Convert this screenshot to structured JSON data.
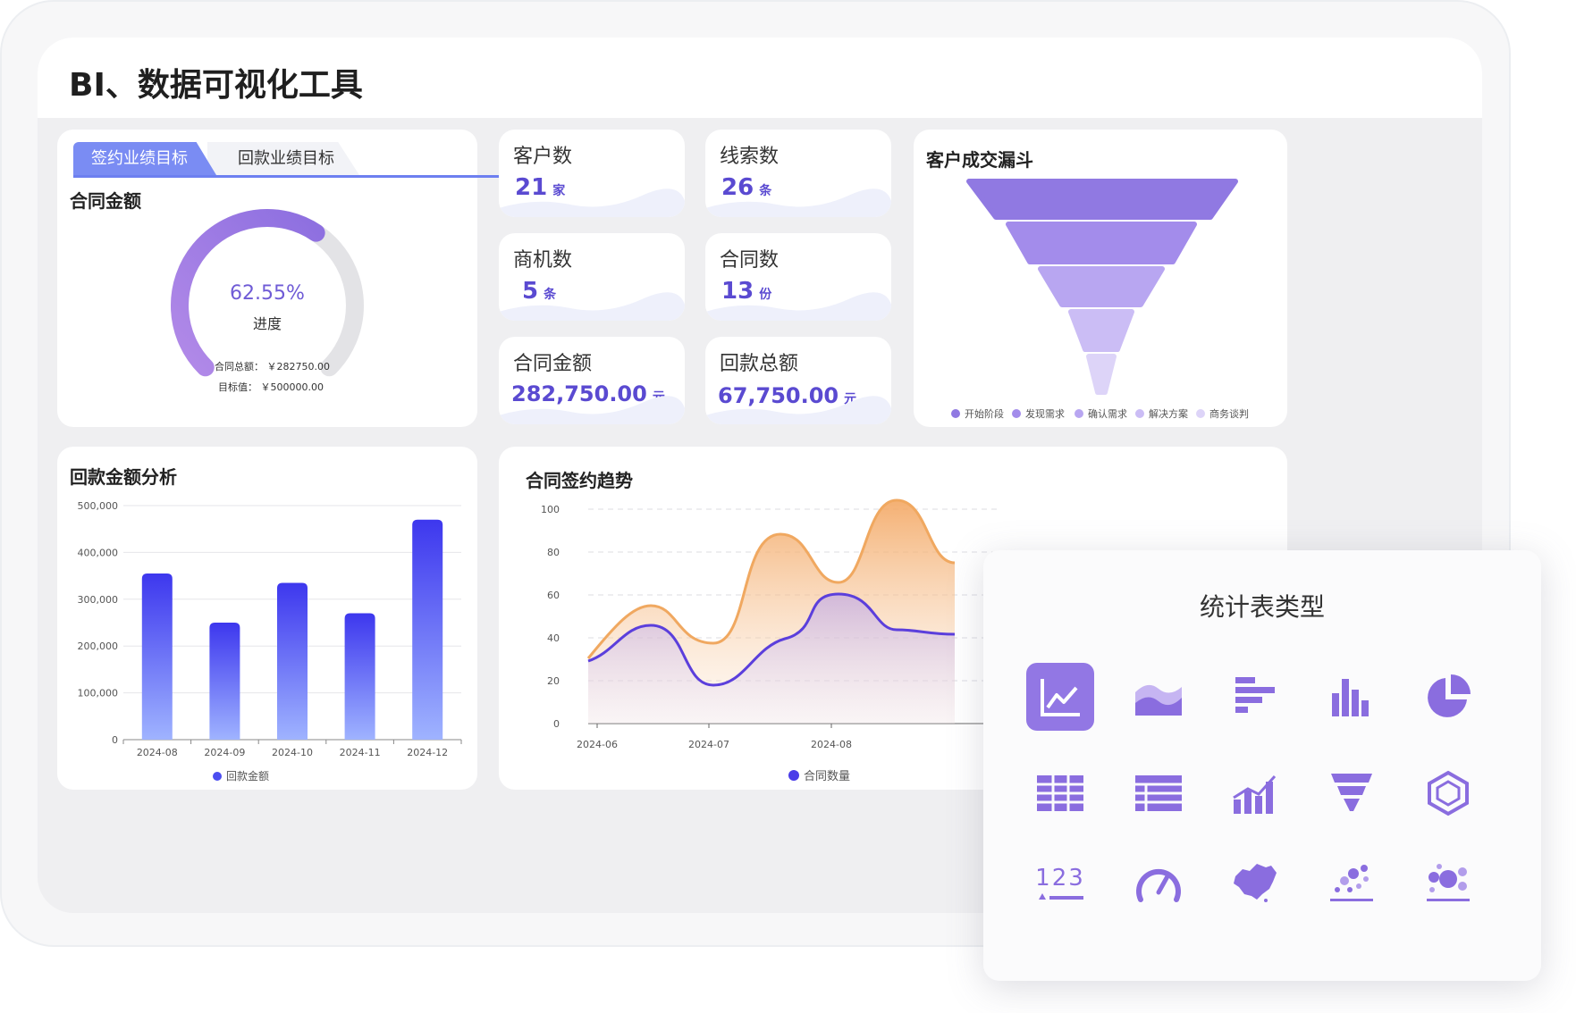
{
  "app": {
    "title": "BI、数据可视化工具"
  },
  "tabs": [
    {
      "label": "签约业绩目标",
      "active": true
    },
    {
      "label": "回款业绩目标",
      "active": false
    }
  ],
  "target_card": {
    "title": "合同金额",
    "progress_percent": 62.55,
    "progress_text": "62.55%",
    "progress_label": "进度",
    "total_label": "合同总额：",
    "total_value": "￥282750.00",
    "target_label": "目标值：",
    "target_value": "￥500000.00"
  },
  "stats": [
    {
      "label": "客户数",
      "value": "21",
      "unit": "家"
    },
    {
      "label": "线索数",
      "value": "26",
      "unit": "条"
    },
    {
      "label": "商机数",
      "value": "5",
      "unit": "条"
    },
    {
      "label": "合同数",
      "value": "13",
      "unit": "份"
    },
    {
      "label": "合同金额",
      "value": "282,750.00",
      "unit": "元"
    },
    {
      "label": "回款总额",
      "value": "67,750.00",
      "unit": "元"
    }
  ],
  "funnel": {
    "title": "客户成交漏斗",
    "stages": [
      {
        "name": "开始阶段",
        "color": "#9079e2"
      },
      {
        "name": "发现需求",
        "color": "#a38ceb"
      },
      {
        "name": "确认需求",
        "color": "#b8a6f1"
      },
      {
        "name": "解决方案",
        "color": "#cbbdf5"
      },
      {
        "name": "商务谈判",
        "color": "#ddd4f8"
      }
    ]
  },
  "colors": {
    "accent": "#5a4ad1",
    "bar_top": "#3d37ee",
    "bar_bottom": "#9fb3ff",
    "orange": "#f0a860",
    "purple_line": "#5b3fdc"
  },
  "charts": {
    "payment": {
      "title": "回款金额分析",
      "legend": "回款金额",
      "chart_data": {
        "type": "bar",
        "categories": [
          "2024-08",
          "2024-09",
          "2024-10",
          "2024-11",
          "2024-12"
        ],
        "series": [
          {
            "name": "回款金额",
            "values": [
              355000,
              250000,
              335000,
              270000,
              470000
            ]
          }
        ],
        "ylim": [
          0,
          500000
        ],
        "yticks": [
          "0",
          "100,000",
          "200,000",
          "300,000",
          "400,000",
          "500,000"
        ],
        "grid": true,
        "legend": "bottom"
      }
    },
    "trend": {
      "title": "合同签约趋势",
      "legend": "合同数量",
      "chart_data": {
        "type": "area",
        "x": [
          "2024-06",
          "2024-07",
          "2024-08"
        ],
        "yticks": [
          "0",
          "20",
          "40",
          "60",
          "80",
          "100"
        ],
        "ylim": [
          0,
          100
        ],
        "grid": true,
        "legend": "bottom"
      }
    }
  },
  "popup": {
    "title": "统计表类型",
    "icons": [
      "line-chart-icon",
      "area-chart-icon",
      "horizontal-bar-icon",
      "bar-chart-icon",
      "pie-chart-icon",
      "table-icon",
      "striped-table-icon",
      "combo-chart-icon",
      "funnel-icon",
      "radar-icon",
      "number-card-icon",
      "gauge-icon",
      "map-icon",
      "scatter-icon",
      "bubble-icon"
    ],
    "number_card_text": "123"
  }
}
